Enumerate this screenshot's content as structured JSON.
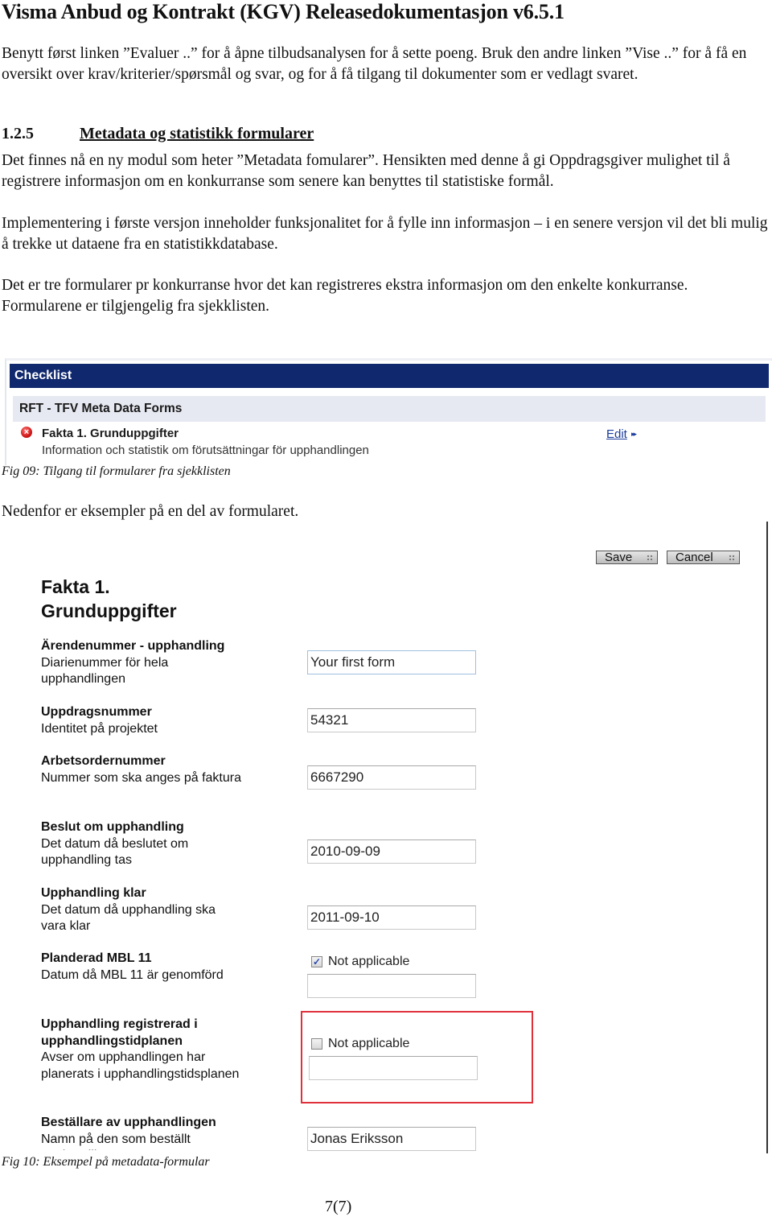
{
  "document": {
    "title": "Visma Anbud og Kontrakt (KGV) Releasedokumentasjon v6.5.1",
    "intro_paragraph": "Benytt først linken ”Evaluer ..” for å åpne tilbudsanalysen for å sette poeng. Bruk den andre linken ”Vise ..” for å få en oversikt over krav/kriterier/spørsmål og svar, og for å få tilgang til dokumenter som er vedlagt svaret.",
    "section": {
      "number": "1.2.5",
      "title": "Metadata og statistikk formularer"
    },
    "paragraph_1": "Det finnes nå en ny modul som heter ”Metadata fomularer”. Hensikten med denne å gi Oppdragsgiver mulighet til å registrere informasjon om en konkurranse som senere kan benyttes til statistiske formål.",
    "paragraph_2": "Implementering i første versjon inneholder funksjonalitet for å fylle inn informasjon – i en senere versjon vil det bli mulig å trekke ut dataene fra en statistikkdatabase.",
    "paragraph_3": "Det er tre formularer pr konkurranse hvor det kan registreres ekstra informasjon om den enkelte konkurranse. Formularene er tilgjengelig fra sjekklisten.",
    "fig09_caption": "Fig 09: Tilgang til formularer fra sjekklisten",
    "paragraph_4": "Nedenfor er eksempler på en del av formularet.",
    "fig10_caption": "Fig 10: Eksempel på metadata-formular",
    "page_number": "7(7)"
  },
  "checklist": {
    "header": "Checklist",
    "group": "RFT - TFV Meta Data Forms",
    "item": {
      "status_icon": "error-x-icon",
      "status_color": "#d01818",
      "title": "Fakta 1. Grunduppgifter",
      "description": "Information och statistik om förutsättningar för upphandlingen",
      "edit_label": "Edit",
      "edit_arrows": "▸▸"
    },
    "header_color": "#10286e"
  },
  "form": {
    "save_label": "Save",
    "cancel_label": "Cancel",
    "title_line1": "Fakta 1.",
    "title_line2": "Grunduppgifter",
    "fields": [
      {
        "label": "Ärendenummer - upphandling",
        "help": "Diarienummer för hela upphandlingen",
        "value": "Your first form"
      },
      {
        "label": "Uppdragsnummer",
        "help": "Identitet på projektet",
        "value": "54321"
      },
      {
        "label": "Arbetsordernummer",
        "help": "Nummer som ska anges på faktura",
        "value": "6667290"
      },
      {
        "label": "Beslut om upphandling",
        "help": "Det datum då beslutet om upphandling tas",
        "value": "2010-09-09"
      },
      {
        "label": "Upphandling klar",
        "help": "Det datum då upphandling ska vara klar",
        "value": "2011-09-10"
      },
      {
        "label": "Planderad MBL 11",
        "help": "Datum då MBL 11 är genomförd",
        "value": "",
        "checkbox_label": "Not applicable",
        "checked": true
      },
      {
        "label": "Upphandling registrerad i upphandlingstidplanen",
        "help": "Avser om upphandlingen har planerats i upphandlingstidsplanen",
        "value": "",
        "checkbox_label": "Not applicable",
        "checked": false,
        "highlighted": true
      },
      {
        "label": "Beställare av upphandlingen",
        "help": "Namn på den som beställt upphandlingen",
        "value": "Jonas Eriksson"
      }
    ],
    "highlight_color": "#e0303a"
  }
}
